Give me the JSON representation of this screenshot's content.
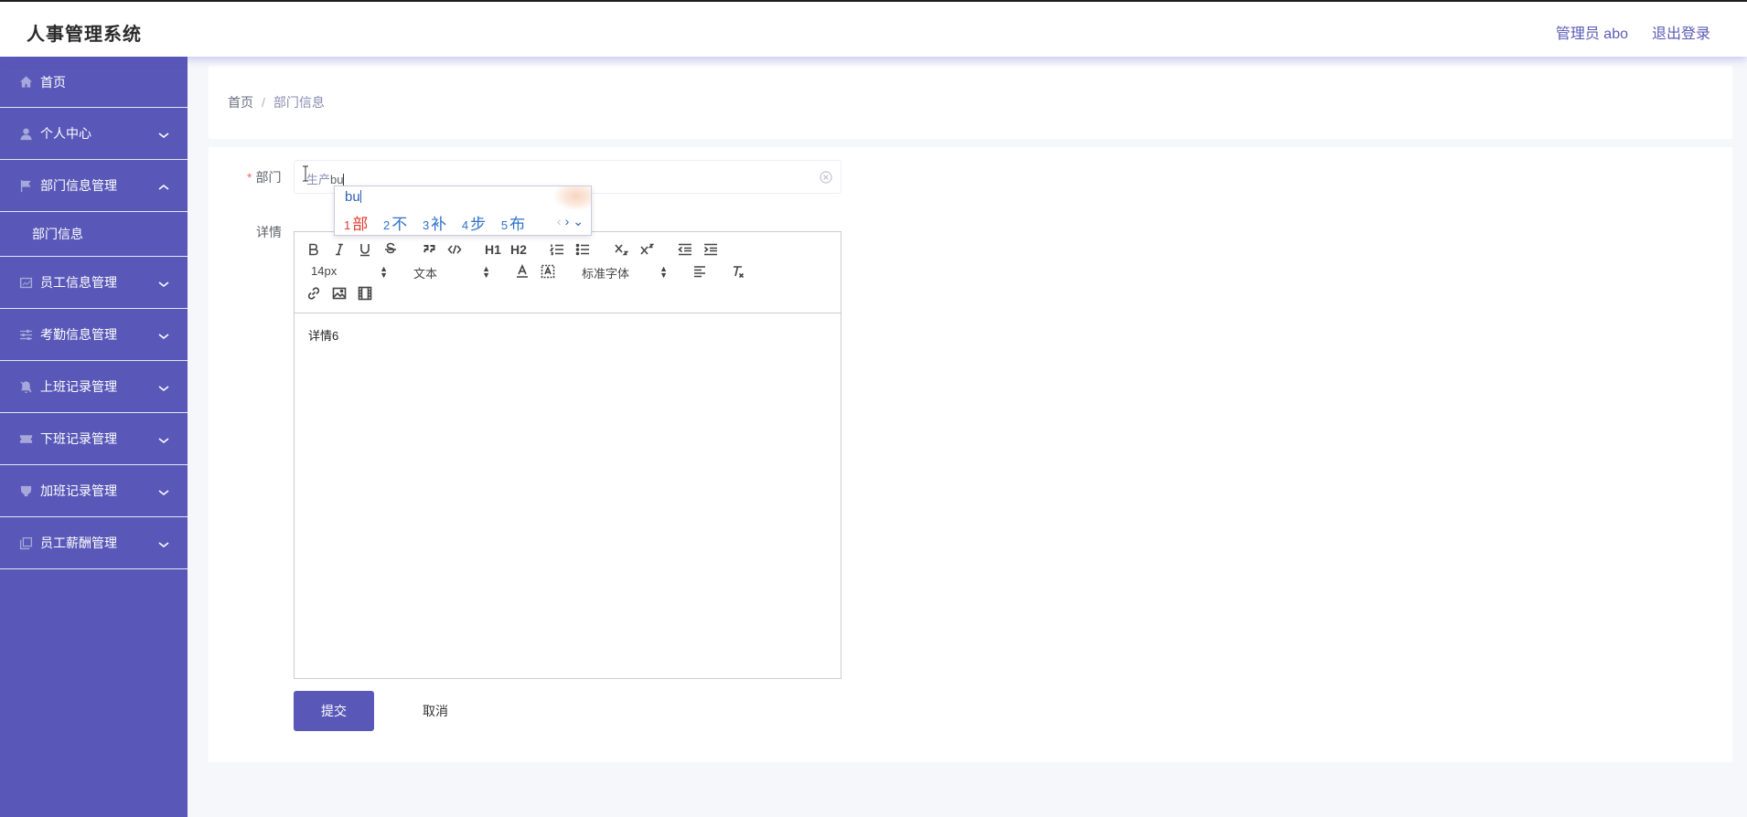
{
  "app": {
    "title": "人事管理系统"
  },
  "header": {
    "user": "管理员 abo",
    "logout": "退出登录"
  },
  "sidebar": {
    "items": [
      {
        "label": "首页",
        "icon": "home-icon"
      },
      {
        "label": "个人中心",
        "icon": "user-icon"
      },
      {
        "label": "部门信息管理",
        "icon": "flag-icon",
        "expanded": true,
        "children": [
          {
            "label": "部门信息"
          }
        ]
      },
      {
        "label": "员工信息管理",
        "icon": "chart-icon"
      },
      {
        "label": "考勤信息管理",
        "icon": "sliders-icon"
      },
      {
        "label": "上班记录管理",
        "icon": "bell-off-icon"
      },
      {
        "label": "下班记录管理",
        "icon": "ticket-icon"
      },
      {
        "label": "加班记录管理",
        "icon": "cup-icon"
      },
      {
        "label": "员工薪酬管理",
        "icon": "copy-icon"
      }
    ]
  },
  "breadcrumb": {
    "home": "首页",
    "separator": "/",
    "current": "部门信息"
  },
  "form": {
    "dept_label": "部门",
    "dept_required_mark": "*",
    "dept_value_committed": "生产",
    "dept_value_composing": "bu",
    "detail_label": "详情",
    "editor_content": "详情6",
    "submit": "提交",
    "cancel": "取消"
  },
  "ime": {
    "composition": "bu",
    "candidates": [
      {
        "num": "1",
        "char": "部"
      },
      {
        "num": "2",
        "char": "不"
      },
      {
        "num": "3",
        "char": "补"
      },
      {
        "num": "4",
        "char": "步"
      },
      {
        "num": "5",
        "char": "布"
      }
    ],
    "nav": {
      "prev": "‹",
      "next": "›",
      "expand": "⌄"
    }
  },
  "toolbar": {
    "font_size": "14px",
    "header_select": "文本",
    "font_family": "标准字体",
    "h1": "H1",
    "h2": "H2"
  },
  "colors": {
    "primary": "#5958b8",
    "required": "#f56c6c",
    "ime_first": "#e0392b",
    "ime_candidate": "#2f72c8"
  }
}
